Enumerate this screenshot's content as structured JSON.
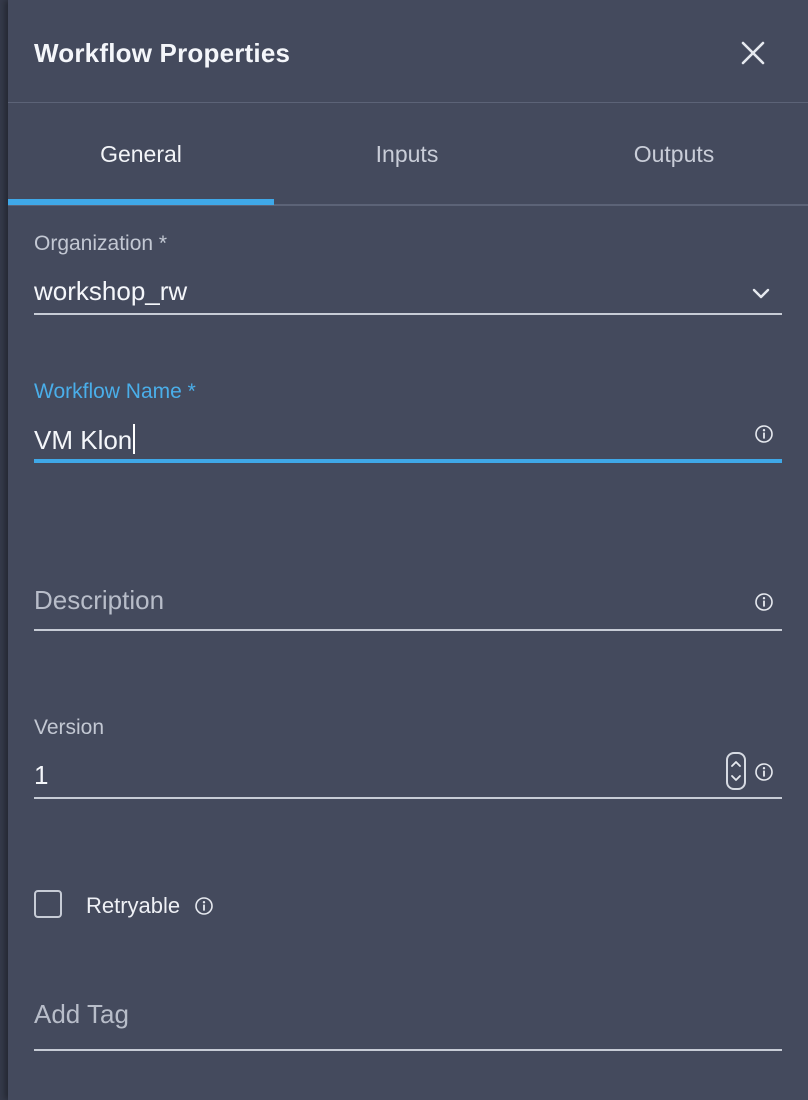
{
  "panel": {
    "title": "Workflow Properties"
  },
  "icons": {
    "close": "close-icon",
    "dropdown": "chevron-down-icon",
    "info": "info-icon",
    "stepper": "stepper-arrows-icon"
  },
  "tabs": [
    {
      "label": "General",
      "active": true
    },
    {
      "label": "Inputs",
      "active": false
    },
    {
      "label": "Outputs",
      "active": false
    }
  ],
  "form": {
    "organization": {
      "label": "Organization *",
      "value": "workshop_rw"
    },
    "workflow_name": {
      "label": "Workflow Name *",
      "value": "VM Klon"
    },
    "description": {
      "placeholder": "Description",
      "value": ""
    },
    "version": {
      "label": "Version",
      "value": "1"
    },
    "retryable": {
      "label": "Retryable",
      "checked": false
    },
    "tags": {
      "placeholder": "Add Tag"
    }
  },
  "colors": {
    "panel_bg": "#444a5d",
    "accent": "#3fa8e8",
    "text": "#f4f6fa",
    "muted_text": "#c3c8d3"
  }
}
